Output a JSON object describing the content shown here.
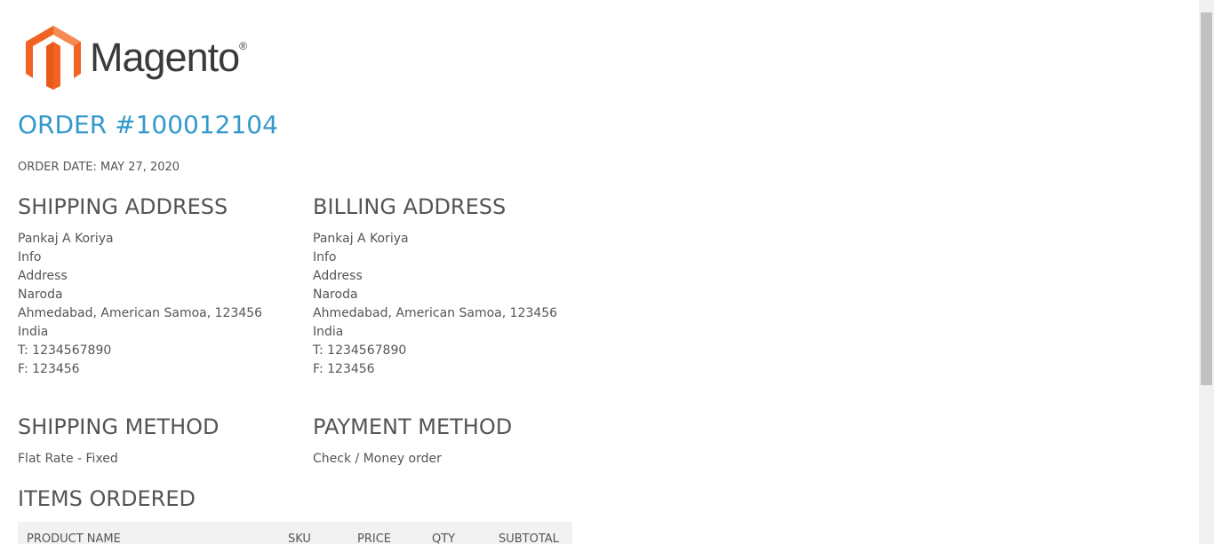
{
  "logo": {
    "text": "Magento",
    "mark": "®"
  },
  "order": {
    "title": "ORDER #100012104",
    "date": "ORDER DATE: MAY 27, 2020"
  },
  "shipping_address": {
    "heading": "SHIPPING ADDRESS",
    "lines": [
      "Pankaj A Koriya",
      "Info",
      "Address",
      "Naroda",
      "Ahmedabad, American Samoa, 123456",
      "India",
      "T: 1234567890",
      "F: 123456"
    ]
  },
  "billing_address": {
    "heading": "BILLING ADDRESS",
    "lines": [
      "Pankaj A Koriya",
      "Info",
      "Address",
      "Naroda",
      "Ahmedabad, American Samoa, 123456",
      "India",
      "T: 1234567890",
      "F: 123456"
    ]
  },
  "shipping_method": {
    "heading": "SHIPPING METHOD",
    "value": "Flat Rate - Fixed"
  },
  "payment_method": {
    "heading": "PAYMENT METHOD",
    "value": "Check / Money order"
  },
  "items": {
    "heading": "ITEMS ORDERED",
    "columns": [
      "PRODUCT NAME",
      "SKU",
      "PRICE",
      "QTY",
      "SUBTOTAL"
    ]
  }
}
